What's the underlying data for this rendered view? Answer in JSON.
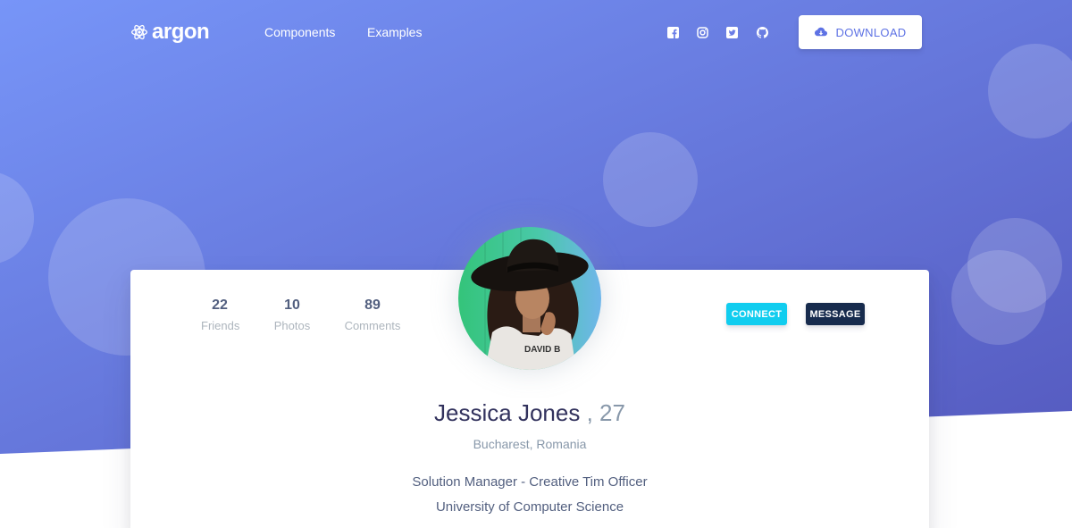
{
  "brand": {
    "name": "argon"
  },
  "nav": {
    "links": [
      "Components",
      "Examples"
    ]
  },
  "social": [
    "facebook-icon",
    "instagram-icon",
    "twitter-icon",
    "github-icon"
  ],
  "download": {
    "label": "DOWNLOAD",
    "icon": "cloud-download-icon"
  },
  "colors": {
    "gradient_start": "#7795f8",
    "gradient_end": "#555abf",
    "primary": "#5e72e4",
    "info": "#11cdef",
    "dark": "#172b4d"
  },
  "profile": {
    "stats": [
      {
        "value": "22",
        "label": "Friends"
      },
      {
        "value": "10",
        "label": "Photos"
      },
      {
        "value": "89",
        "label": "Comments"
      }
    ],
    "connect_label": "CONNECT",
    "message_label": "MESSAGE",
    "name": "Jessica Jones",
    "age": ", 27",
    "location": "Bucharest, Romania",
    "job": "Solution Manager - Creative Tim Officer",
    "school": "University of Computer Science",
    "avatar_shirt_text": "DAVID B"
  }
}
